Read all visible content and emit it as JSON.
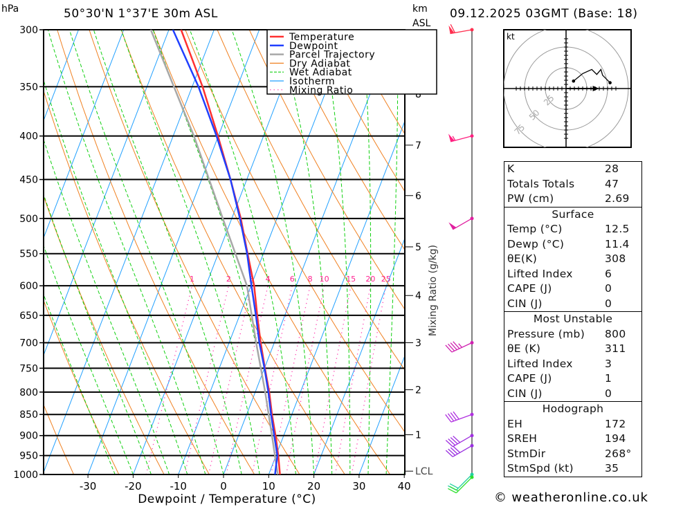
{
  "header": {
    "pressure_unit": "hPa",
    "location": "50°30'N 1°37'E 30m ASL",
    "height_unit_1": "km",
    "height_unit_2": "ASL",
    "datetime": "09.12.2025 03GMT (Base: 18)"
  },
  "chart_data": {
    "type": "skew-t",
    "xlabel": "Dewpoint / Temperature (°C)",
    "ylabel": "hPa",
    "secondary_ylabel": "Mixing Ratio (g/kg)",
    "pressure_range": [
      1000,
      300
    ],
    "temperature_range_at_1000": [
      -40,
      40
    ],
    "x_ticks": [
      -30,
      -20,
      -10,
      0,
      10,
      20,
      30,
      40
    ],
    "pressure_ticks": [
      300,
      350,
      400,
      450,
      500,
      550,
      600,
      650,
      700,
      750,
      800,
      850,
      900,
      950,
      1000
    ],
    "height_ticks_km": [
      {
        "label": "8",
        "pressure": 357
      },
      {
        "label": "7",
        "pressure": 410
      },
      {
        "label": "6",
        "pressure": 470
      },
      {
        "label": "5",
        "pressure": 540
      },
      {
        "label": "4",
        "pressure": 616
      },
      {
        "label": "3",
        "pressure": 700
      },
      {
        "label": "2",
        "pressure": 795
      },
      {
        "label": "1",
        "pressure": 898
      },
      {
        "label": "LCL",
        "pressure": 991
      }
    ],
    "legend": [
      {
        "name": "Temperature",
        "color": "#ff3030",
        "style": "solid-thick"
      },
      {
        "name": "Dewpoint",
        "color": "#2040ff",
        "style": "solid-thick"
      },
      {
        "name": "Parcel Trajectory",
        "color": "#a8a8a8",
        "style": "solid-thick"
      },
      {
        "name": "Dry Adiabat",
        "color": "#f08020",
        "style": "solid"
      },
      {
        "name": "Wet Adiabat",
        "color": "#10d010",
        "style": "dashed"
      },
      {
        "name": "Isotherm",
        "color": "#20a0ff",
        "style": "solid"
      },
      {
        "name": "Mixing Ratio",
        "color": "#ff40b0",
        "style": "dotted"
      }
    ],
    "legend_position": "top-right",
    "mixing_ratio_lines": [
      1,
      2,
      3,
      4,
      6,
      8,
      10,
      15,
      20,
      25
    ],
    "temperature": [
      [
        1000,
        12.5
      ],
      [
        950,
        10.5
      ],
      [
        900,
        8.2
      ],
      [
        850,
        5.6
      ],
      [
        800,
        3.1
      ],
      [
        750,
        0.1
      ],
      [
        700,
        -3.0
      ],
      [
        650,
        -6.1
      ],
      [
        600,
        -9.3
      ],
      [
        550,
        -13.5
      ],
      [
        500,
        -18.0
      ],
      [
        450,
        -23.6
      ],
      [
        400,
        -30.1
      ],
      [
        350,
        -37.7
      ],
      [
        300,
        -47.3
      ]
    ],
    "dewpoint": [
      [
        1000,
        11.4
      ],
      [
        950,
        10.3
      ],
      [
        900,
        7.9
      ],
      [
        850,
        5.4
      ],
      [
        800,
        2.9
      ],
      [
        750,
        0.0
      ],
      [
        700,
        -3.3
      ],
      [
        650,
        -6.4
      ],
      [
        600,
        -9.9
      ],
      [
        550,
        -13.6
      ],
      [
        500,
        -18.2
      ],
      [
        450,
        -23.6
      ],
      [
        400,
        -30.4
      ],
      [
        350,
        -38.6
      ],
      [
        300,
        -49.1
      ]
    ],
    "parcel": [
      [
        1000,
        12.0
      ],
      [
        900,
        7.4
      ],
      [
        800,
        2.2
      ],
      [
        700,
        -4.0
      ],
      [
        600,
        -10.9
      ],
      [
        500,
        -22.0
      ],
      [
        400,
        -35.4
      ],
      [
        300,
        -54.0
      ]
    ],
    "wind_barbs": [
      {
        "pressure": 300,
        "direction": 260,
        "speed_kt": 60,
        "color": "#ff3050"
      },
      {
        "pressure": 400,
        "direction": 255,
        "speed_kt": 55,
        "color": "#ff2080"
      },
      {
        "pressure": 500,
        "direction": 240,
        "speed_kt": 50,
        "color": "#e020a0"
      },
      {
        "pressure": 700,
        "direction": 245,
        "speed_kt": 45,
        "color": "#d020b0"
      },
      {
        "pressure": 850,
        "direction": 250,
        "speed_kt": 40,
        "color": "#b030e0"
      },
      {
        "pressure": 900,
        "direction": 240,
        "speed_kt": 40,
        "color": "#a030e0"
      },
      {
        "pressure": 925,
        "direction": 240,
        "speed_kt": 40,
        "color": "#9a30e0"
      },
      {
        "pressure": 1000,
        "direction": 225,
        "speed_kt": 20,
        "color": "#20d0a0"
      },
      {
        "pressure": 1000,
        "direction": 225,
        "speed_kt": 20,
        "color": "#30e030"
      }
    ]
  },
  "hodograph": {
    "unit": "kt",
    "rings": [
      25,
      50,
      75
    ],
    "points_uv_kt": [
      [
        9,
        9
      ],
      [
        20,
        18
      ],
      [
        31,
        23
      ],
      [
        37,
        17
      ],
      [
        42,
        23
      ],
      [
        44,
        16
      ],
      [
        53,
        7
      ]
    ],
    "storm_motion_uv_kt": [
      33,
      0
    ]
  },
  "indices": {
    "rows": [
      {
        "label": "K",
        "value": "28"
      },
      {
        "label": "Totals Totals",
        "value": "47"
      },
      {
        "label": "PW (cm)",
        "value": "2.69"
      }
    ]
  },
  "surface": {
    "title": "Surface",
    "rows": [
      {
        "label": "Temp (°C)",
        "value": "12.5"
      },
      {
        "label": "Dewp (°C)",
        "value": "11.4"
      },
      {
        "label": "θE(K)",
        "value": "308"
      },
      {
        "label": "Lifted Index",
        "value": "6"
      },
      {
        "label": "CAPE (J)",
        "value": "0"
      },
      {
        "label": "CIN (J)",
        "value": "0"
      }
    ]
  },
  "most_unstable": {
    "title": "Most Unstable",
    "rows": [
      {
        "label": "Pressure (mb)",
        "value": "800"
      },
      {
        "label": "θE (K)",
        "value": "311"
      },
      {
        "label": "Lifted Index",
        "value": "3"
      },
      {
        "label": "CAPE (J)",
        "value": "1"
      },
      {
        "label": "CIN (J)",
        "value": "0"
      }
    ]
  },
  "hodograph_table": {
    "title": "Hodograph",
    "rows": [
      {
        "label": "EH",
        "value": "172"
      },
      {
        "label": "SREH",
        "value": "194"
      },
      {
        "label": "StmDir",
        "value": "268°"
      },
      {
        "label": "StmSpd (kt)",
        "value": "35"
      }
    ]
  },
  "footer": {
    "copyright": "© weatheronline.co.uk"
  }
}
